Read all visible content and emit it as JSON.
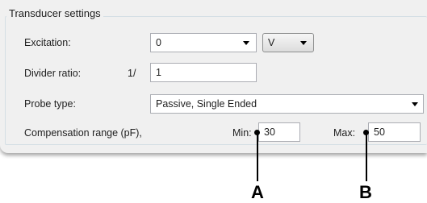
{
  "group": {
    "title": "Transducer settings"
  },
  "excitation": {
    "label": "Excitation:",
    "value": "0",
    "unit": "V"
  },
  "divider": {
    "label": "Divider ratio:",
    "prefix": "1/",
    "value": "1"
  },
  "probe": {
    "label": "Probe type:",
    "value": "Passive, Single Ended"
  },
  "compensation": {
    "label": "Compensation range (pF),",
    "min_label": "Min:",
    "min_value": "30",
    "max_label": "Max:",
    "max_value": "50"
  },
  "callouts": {
    "a": "A",
    "b": "B"
  }
}
